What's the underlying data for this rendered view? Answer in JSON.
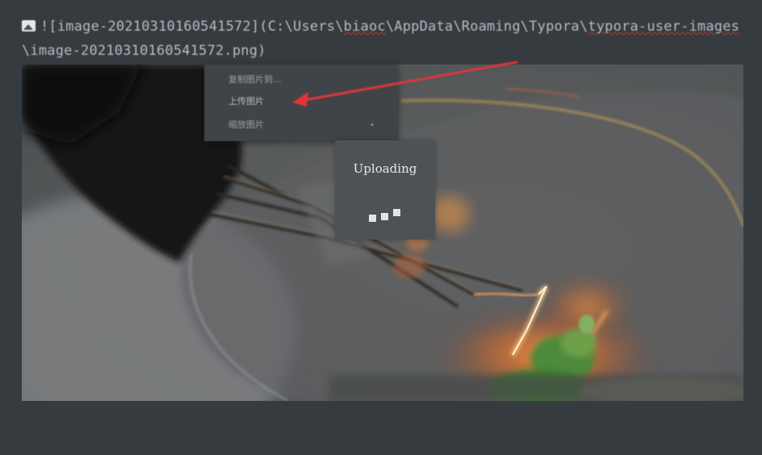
{
  "markdown": {
    "line_prefix": "![image-20210310160541572](C:\\Users\\",
    "user_name": "biaoc",
    "path_mid": "\\AppData\\Roaming\\Typora\\",
    "folder_name": "typora-user-images",
    "line_suffix": "\\image-20210310160541572.png)"
  },
  "context_menu": {
    "items": [
      {
        "label": "复制图片到..."
      },
      {
        "label": "上传图片"
      },
      {
        "label": "缩放图片"
      }
    ]
  },
  "upload_dialog": {
    "title": "Uploading"
  },
  "colors": {
    "background": "#363b40",
    "annotation_arrow": "#e53935",
    "dialog": "#4d5257",
    "menu": "#3f4448"
  },
  "icons": {
    "image": "image-icon",
    "submenu": "chevron-right-icon"
  }
}
